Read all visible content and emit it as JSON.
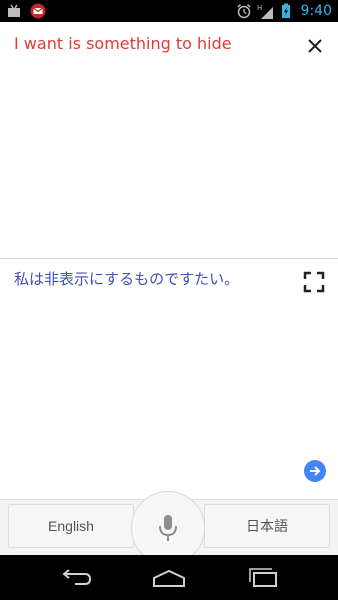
{
  "status_bar": {
    "left_icons": [
      "android-debug-icon",
      "gmail-icon"
    ],
    "right_icons": [
      "alarm-icon",
      "signal-icon",
      "battery-icon"
    ],
    "network_label": "H",
    "time": "9:40",
    "accent": "#33b5e5"
  },
  "source": {
    "text": "I want is something to hide",
    "color": "#e53935",
    "close_icon": "close-icon"
  },
  "result": {
    "text": "私は非表示にするものですたい。",
    "color": "#3f51b5",
    "fullscreen_icon": "fullscreen-icon",
    "go_icon": "arrow-right-icon"
  },
  "language_bar": {
    "source_language": "English",
    "target_language": "日本語",
    "mic_icon": "mic-icon"
  },
  "nav_bar": {
    "icons": [
      "back-icon",
      "home-icon",
      "recents-icon"
    ]
  }
}
